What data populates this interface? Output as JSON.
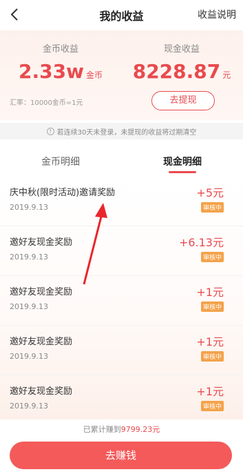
{
  "header": {
    "title": "我的收益",
    "help_label": "收益说明"
  },
  "summary": {
    "coin_label": "金币收益",
    "coin_value": "2.33w",
    "coin_unit": "金币",
    "cash_label": "现金收益",
    "cash_value": "8228.87",
    "cash_unit": "元",
    "rate_text": "汇率：10000金币=1元",
    "withdraw_label": "去提现"
  },
  "notice": {
    "text": "若连续30天未登录，未提现的收益将过期清空"
  },
  "tabs": [
    {
      "label": "金币明细",
      "active": false
    },
    {
      "label": "现金明细",
      "active": true
    }
  ],
  "records": [
    {
      "title": "庆中秋(限时活动)邀请奖励",
      "date": "2019.9.13",
      "amount": "+5元",
      "status": "审核中"
    },
    {
      "title": "邀好友现金奖励",
      "date": "2019.9.13",
      "amount": "+6.13元",
      "status": "审核中"
    },
    {
      "title": "邀好友现金奖励",
      "date": "2019.9.13",
      "amount": "+1元",
      "status": "审核中"
    },
    {
      "title": "邀好友现金奖励",
      "date": "2019.9.13",
      "amount": "+1元",
      "status": "审核中"
    },
    {
      "title": "邀好友现金奖励",
      "date": "2019.9.13",
      "amount": "+1元",
      "status": "审核中"
    }
  ],
  "footer": {
    "total_prefix": "已累计赚到",
    "total_amount": "9799.23元",
    "earn_label": "去赚钱"
  },
  "colors": {
    "accent": "#e84a4e",
    "badge": "#f4a24a",
    "button": "#f45a5a"
  },
  "icons": {
    "back": "back-icon",
    "info": "info-icon",
    "annotation": "arrow-icon"
  }
}
